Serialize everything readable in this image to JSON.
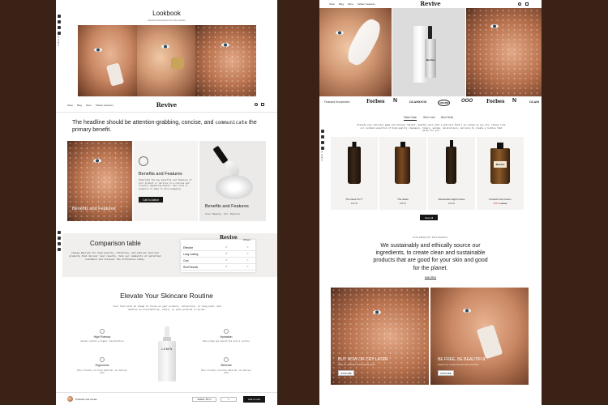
{
  "left": {
    "lookbook": {
      "title": "Lookbook",
      "subtitle": "Optional description for this section"
    },
    "header": {
      "logo": "Revive",
      "nav": [
        "Shop",
        "Blog",
        "More",
        "Tabber Features"
      ]
    },
    "headline": {
      "text": "The headline should be attention-grabbing, concise, and ",
      "emph": "communicate",
      "text2": " the primary benefit."
    },
    "benefits": {
      "card1_label": "Benefits and Features",
      "card2_title": "Benefits and Features",
      "card2_body": "Highlight the key benefits and features of your product or service in a concise and visually appealing manner. Use icons or graphics to make it more engaging.",
      "card2_button": "Call to Action",
      "card3_title": "Benefits and Features",
      "card3_sub": "Your Beauty, Our Passion"
    },
    "comparison": {
      "title": "Comparison table",
      "body": "Choose Revive® for high-quality, effective, and ethical skincare products that deliver real results. Join our community of satisfied customers and discover the difference today.",
      "brand": "Revive",
      "others": "Others",
      "rows": [
        "Effective",
        "Long-Lasting",
        "Cost",
        "Real Results"
      ]
    },
    "routine": {
      "title": "Elevate Your Skincare Routine",
      "body": "Your text with an image to focus on your product, collection, or blog post. Add details on availability, style, or even provide a review.",
      "features": [
        {
          "title": "High Potency",
          "body": "Serums contain a higher concentration"
        },
        {
          "title": "Hydration",
          "body": "Help plump and smooth the skin's surface"
        },
        {
          "title": "Ergonomic",
          "body": "Skin-friendly silicone material can deliver heat"
        },
        {
          "title": "Skincare",
          "body": "Skin-friendly silicone material can deliver heat"
        }
      ],
      "bottle_label": "LUMIN"
    },
    "sticky": {
      "product": "Probiotic Gel Cream",
      "variant": "Default / 50 ml",
      "qty": "1",
      "button": "Add to Cart"
    }
  },
  "right": {
    "header": {
      "logo": "Revive",
      "nav": [
        "Shop",
        "Blog",
        "More",
        "Tabber Features"
      ]
    },
    "bottle_label": "Revive",
    "featured_label": "Featured Everywhere",
    "press": [
      "Forbes",
      "N",
      "GLAMOUR",
      "AWARD",
      "OOO",
      "Forbes",
      "N",
      "GLAM"
    ],
    "tabs": [
      "Face Care",
      "Skin Care",
      "Best Sells"
    ],
    "intro": "Elevate your skincare game and achieve radiant, healthy skin with a skincare that's as unique as you are. Choose from our curated selection of high-quality cleansers, toners, serums, moisturizers, and more to create a routine that works for you.",
    "products": [
      {
        "name": "The Glow Pro™",
        "price": "£32.00",
        "sale": false
      },
      {
        "name": "The Glaze",
        "price": "£45.00",
        "sale": false
      },
      {
        "name": "Restorative Night Cream",
        "price": "£25.00",
        "sale": false
      },
      {
        "name": "Probiotic Gel Cream",
        "price": "£25.00",
        "was": "£35.00",
        "sale": true
      }
    ],
    "view_all": "View All",
    "ethos": {
      "eyebrow": "OUR PRODUCT PHILOSOPHY",
      "text": "We sustainably and ethically source our ingredients, to create clean and sustainable products that are good for your skin and good for the planet.",
      "link": "Learn More"
    },
    "promo": [
      {
        "title": "BUY NOW OR CRY LATER",
        "body": "Shop our collection at discounted prices",
        "button": "EXPLORE"
      },
      {
        "title": "BE FREE, BE BEAUTIFUL",
        "body": "Explore our cruelty-free skin care essentials",
        "button": "EXPLORE"
      }
    ]
  },
  "colors": {
    "background": "#3b2216",
    "dark": "#161616",
    "card": "#f4f3f1",
    "sale": "#c0392b"
  }
}
